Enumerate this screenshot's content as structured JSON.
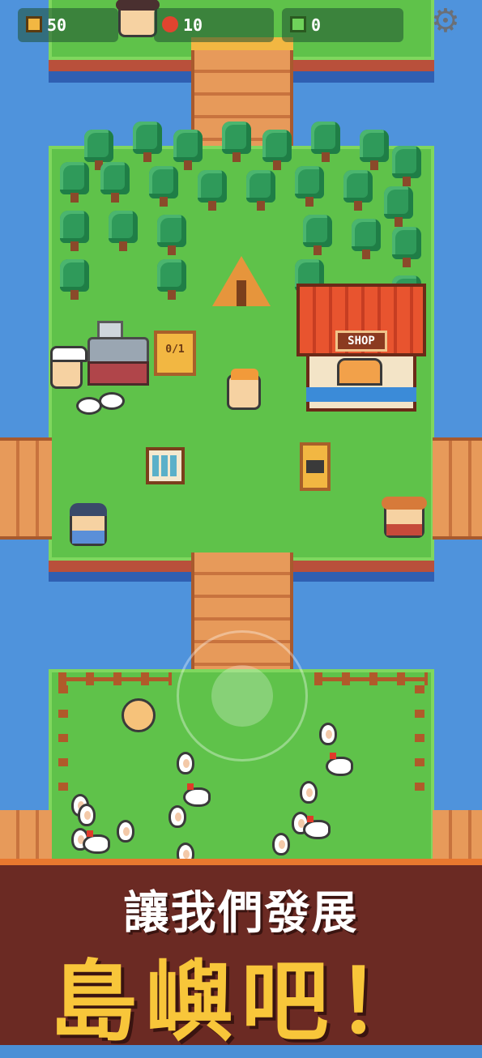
{
  "hud": {
    "coins": "50",
    "food": "10",
    "gems": "0",
    "settings_icon": "gear-icon"
  },
  "sign": {
    "progress": "0/1"
  },
  "shop": {
    "label": "SHOP"
  },
  "banner": {
    "line1": "讓我們發展",
    "line2": "島嶼吧！"
  },
  "colors": {
    "water": "#4f93dc",
    "grass": "#5fc24a",
    "banner_bg": "#6b2a23",
    "banner_accent": "#f8c63a"
  }
}
